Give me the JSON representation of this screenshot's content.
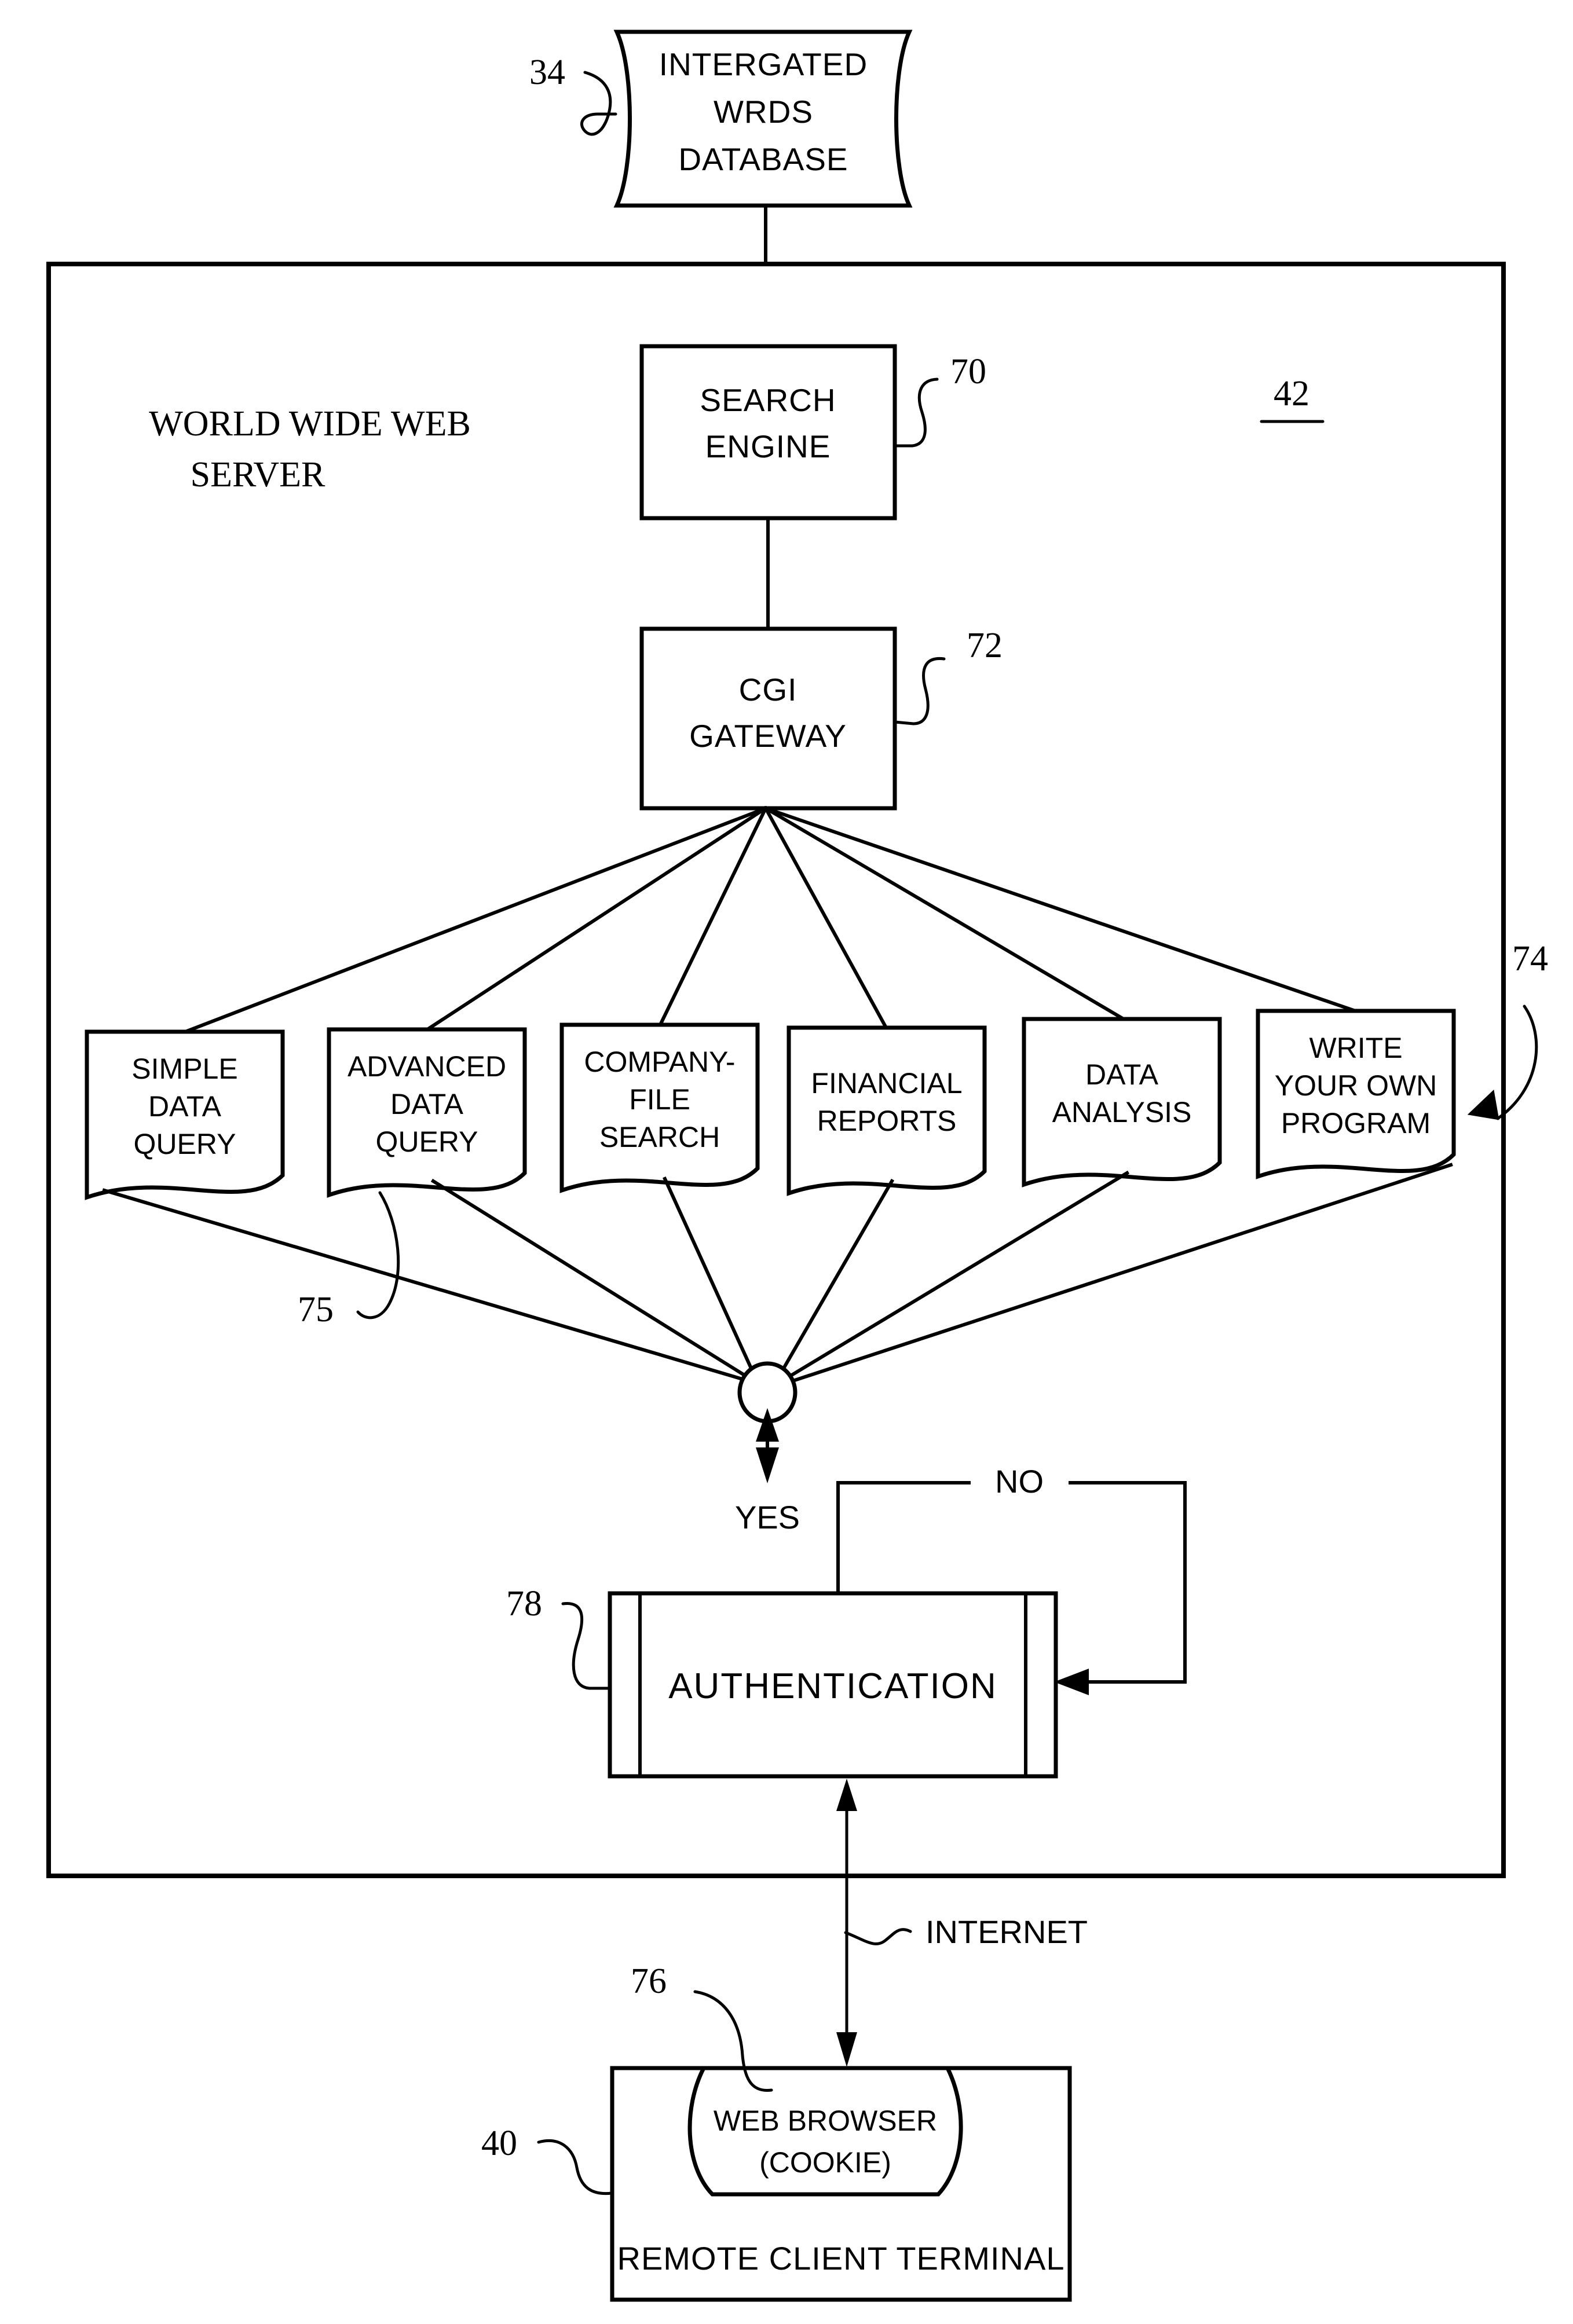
{
  "figure": {
    "title": "WWW server data query architecture flow diagram",
    "stroke_color": "#000000",
    "background_color": "#ffffff"
  },
  "database": {
    "label_lines": [
      "INTERGATED",
      "WRDS",
      "DATABASE"
    ],
    "ref": "34"
  },
  "server": {
    "title_lines": [
      "WORLD WIDE WEB",
      "SERVER"
    ],
    "ref": "42"
  },
  "search_engine": {
    "label_lines": [
      "SEARCH",
      "ENGINE"
    ],
    "ref": "70"
  },
  "cgi_gateway": {
    "label_lines": [
      "CGI",
      "GATEWAY"
    ],
    "ref": "72"
  },
  "options": {
    "group_ref": "74",
    "item_ref": "75",
    "items": [
      {
        "lines": [
          "SIMPLE",
          "DATA",
          "QUERY"
        ]
      },
      {
        "lines": [
          "ADVANCED",
          "DATA",
          "QUERY"
        ]
      },
      {
        "lines": [
          "COMPANY-",
          "FILE",
          "SEARCH"
        ]
      },
      {
        "lines": [
          "FINANCIAL",
          "REPORTS"
        ]
      },
      {
        "lines": [
          "DATA",
          "ANALYSIS"
        ]
      },
      {
        "lines": [
          "WRITE",
          "YOUR OWN",
          "PROGRAM"
        ]
      }
    ]
  },
  "decision": {
    "yes_label": "YES",
    "no_label": "NO"
  },
  "authentication": {
    "label": "AUTHENTICATION",
    "ref": "78"
  },
  "internet": {
    "label": "INTERNET"
  },
  "client": {
    "terminal_label": "REMOTE CLIENT TERMINAL",
    "browser_lines": [
      "WEB BROWSER",
      "(COOKIE)"
    ],
    "browser_ref": "76",
    "terminal_ref": "40"
  }
}
